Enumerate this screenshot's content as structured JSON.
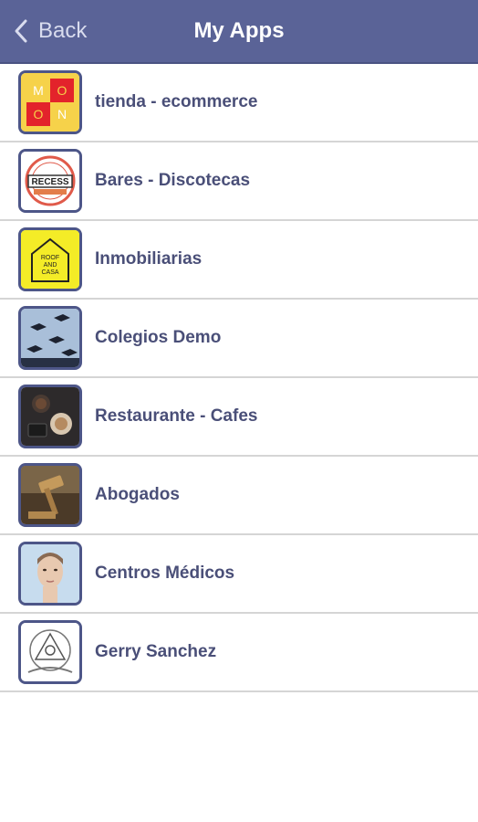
{
  "header": {
    "back_label": "Back",
    "title": "My Apps"
  },
  "apps": [
    {
      "name": "tienda - ecommerce",
      "icon": "moon-logo-icon"
    },
    {
      "name": "Bares - Discotecas",
      "icon": "recess-badge-icon"
    },
    {
      "name": "Inmobiliarias",
      "icon": "roof-and-casa-icon"
    },
    {
      "name": "Colegios Demo",
      "icon": "graduation-caps-icon"
    },
    {
      "name": "Restaurante - Cafes",
      "icon": "coffee-table-icon"
    },
    {
      "name": "Abogados",
      "icon": "gavel-icon"
    },
    {
      "name": "Centros Médicos",
      "icon": "face-portrait-icon"
    },
    {
      "name": "Gerry Sanchez",
      "icon": "emblem-icon"
    }
  ],
  "logo_text": {
    "moon": [
      "M",
      "O",
      "O",
      "N"
    ],
    "recess": "RECESS",
    "roof": [
      "ROOF",
      "AND",
      "CASA"
    ]
  }
}
